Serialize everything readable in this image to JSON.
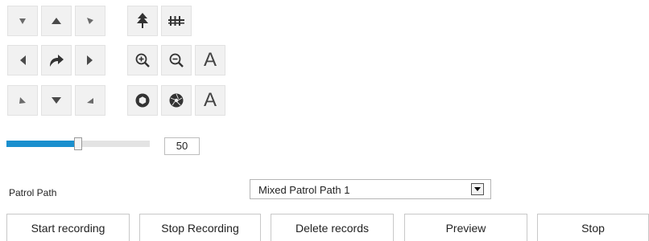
{
  "ptz_controls": {
    "directions": [
      "up-left",
      "up",
      "up-right",
      "left",
      "auto-pan",
      "right",
      "down-left",
      "down",
      "down-right"
    ],
    "lens": [
      "zoom-in",
      "zoom-out",
      "focus-near",
      "focus-far",
      "iris-open",
      "iris-close"
    ],
    "focus_near_glyph": "A",
    "focus_far_glyph": "A"
  },
  "speed": {
    "value": "50",
    "fraction": 0.5,
    "accent": "#1a8fce"
  },
  "patrol": {
    "label": "Patrol Path",
    "selected": "Mixed Patrol Path 1"
  },
  "buttons": {
    "start_recording": "Start recording",
    "stop_recording": "Stop Recording",
    "delete_records": "Delete records",
    "preview": "Preview",
    "stop": "Stop"
  }
}
